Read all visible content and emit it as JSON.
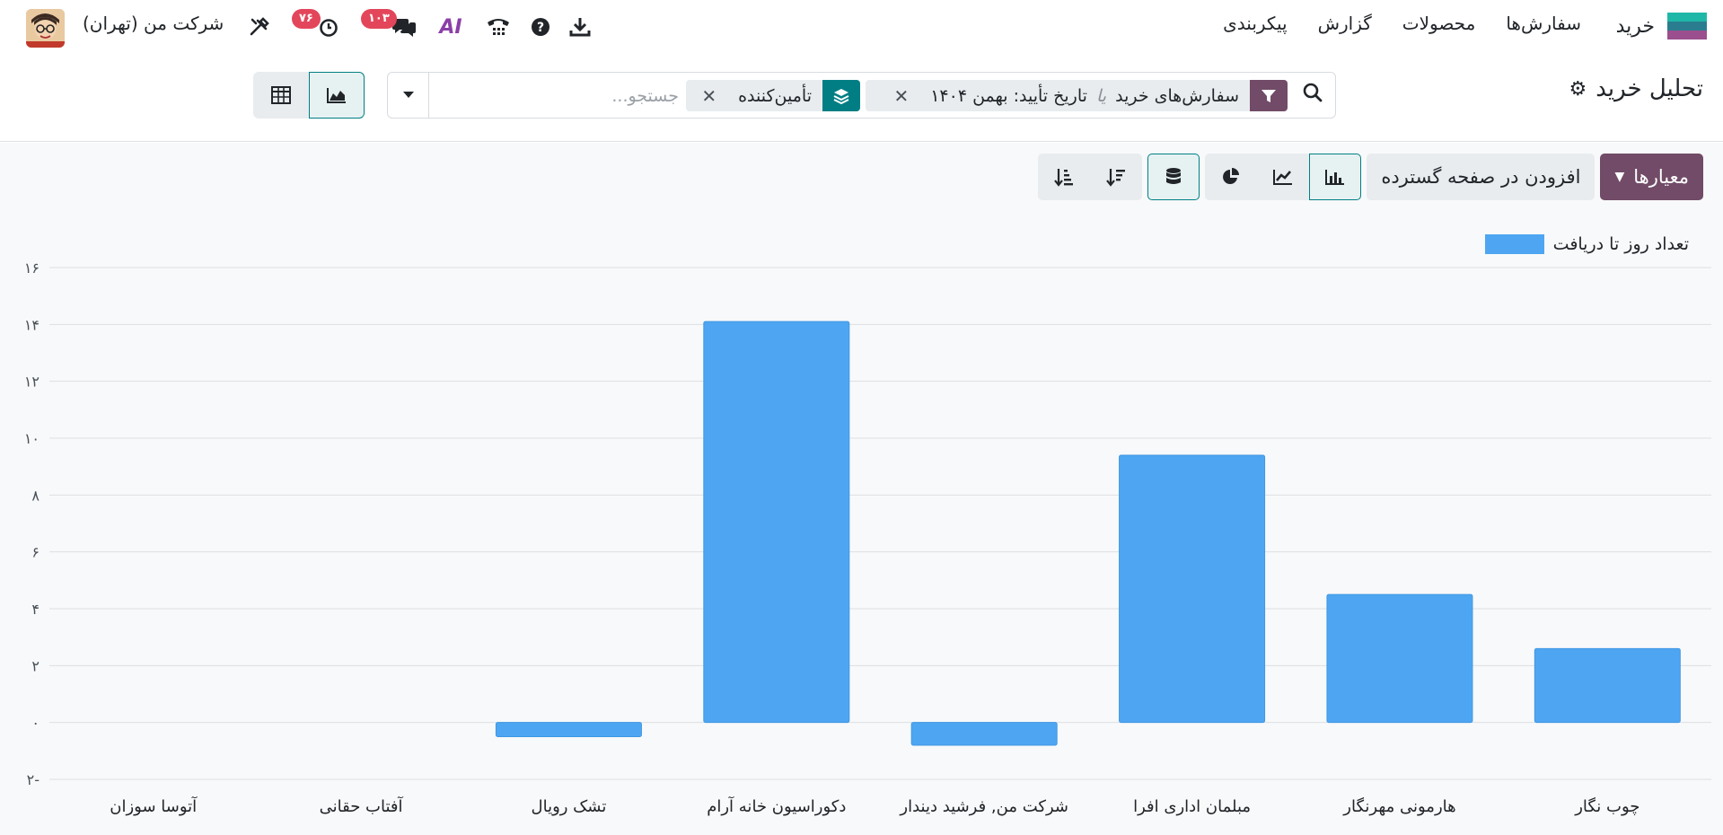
{
  "navbar": {
    "app_name": "خرید",
    "menu": [
      "سفارش‌ها",
      "محصولات",
      "گزارش",
      "پیکربندی"
    ],
    "company": "شرکت من (تهران)",
    "activity_badge": "۷۶",
    "messages_badge": "۱۰۳",
    "ai_label": "AI"
  },
  "control": {
    "title": "تحلیل خرید",
    "facet1_label": "سفارش‌های خرید",
    "facet1_sep": "یا",
    "facet1_value": "تاریخ تأیید: بهمن ۱۴۰۴",
    "facet2_label": "تأمین‌کننده",
    "search_placeholder": "جستجو..."
  },
  "toolbar": {
    "measures_label": "معیارها",
    "insert_label": "افزودن در صفحه گسترده"
  },
  "colors": {
    "bar": "#4ea6f2",
    "primary": "#714b67",
    "teal": "#017e84"
  },
  "chart_data": {
    "type": "bar",
    "categories": [
      "چوب نگار",
      "هارمونی مهرنگار",
      "مبلمان اداری افرا",
      "شرکت من, فرشید دیندار",
      "دکوراسیون خانه آرام",
      "تشک رویال",
      "آفتاب حقانی",
      "آتوسا سوزان"
    ],
    "series": [
      {
        "name": "تعداد روز تا دریافت",
        "values": [
          2.6,
          4.5,
          9.4,
          -0.8,
          14.1,
          -0.5,
          0,
          0
        ]
      }
    ],
    "ylim": [
      -2,
      16
    ],
    "yticks": [
      -2,
      0,
      2,
      4,
      6,
      8,
      10,
      12,
      14,
      16
    ],
    "ytick_labels": [
      "۲-",
      "۰",
      "۲",
      "۴",
      "۶",
      "۸",
      "۱۰",
      "۱۲",
      "۱۴",
      "۱۶"
    ],
    "legend": "top-right",
    "grid": true
  }
}
